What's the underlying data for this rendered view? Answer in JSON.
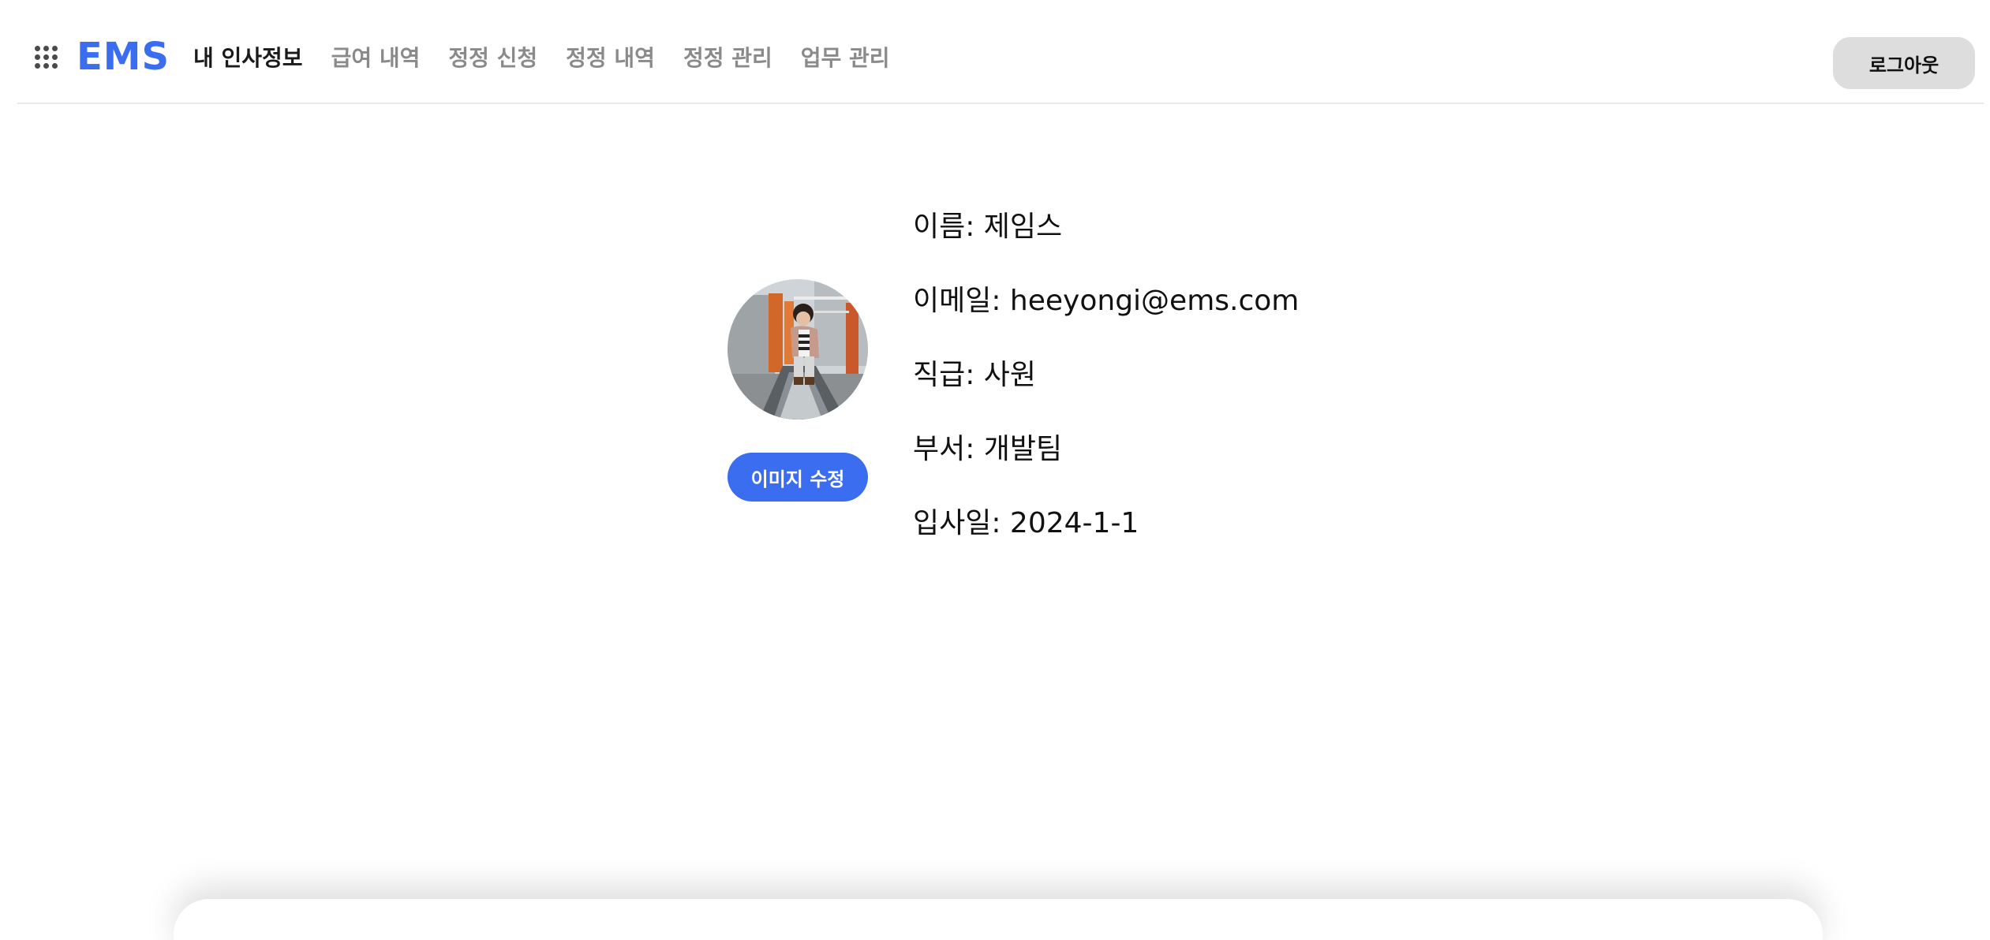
{
  "brand": {
    "logo_text": "EMS",
    "accent_color": "#3a6df0",
    "apps_icon": "apps-grid-icon"
  },
  "nav": {
    "items": [
      {
        "label": "내 인사정보",
        "active": true
      },
      {
        "label": "급여 내역",
        "active": false
      },
      {
        "label": "정정 신청",
        "active": false
      },
      {
        "label": "정정 내역",
        "active": false
      },
      {
        "label": "정정 관리",
        "active": false
      },
      {
        "label": "업무 관리",
        "active": false
      }
    ]
  },
  "header": {
    "logout_label": "로그아웃"
  },
  "profile": {
    "edit_image_label": "이미지 수정",
    "rows": [
      {
        "text": "이름: 제임스"
      },
      {
        "text": "이메일: heeyongi@ems.com"
      },
      {
        "text": "직급: 사원"
      },
      {
        "text": "부서: 개발팀"
      },
      {
        "text": "입사일: 2024-1-1"
      }
    ]
  }
}
